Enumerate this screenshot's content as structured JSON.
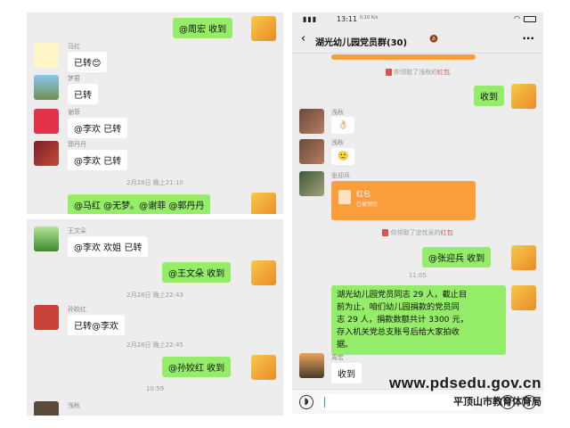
{
  "panel_a": {
    "top_msg": "@周宏  收到",
    "m1": {
      "name": "马红",
      "text": "已转😊"
    },
    "m2": {
      "name": "梦君",
      "text": "已转"
    },
    "m3": {
      "name": "谢菲",
      "text": "@李欢  已转"
    },
    "m4": {
      "name": "郭丹丹",
      "text": "@李欢  已转"
    },
    "time1": "2月28日 晚上21:10",
    "bottom_msg": "@马红 @无梦。@谢菲 @郭丹丹"
  },
  "panel_b": {
    "m1": {
      "name": "王文朵",
      "text": "@李欢  欢姐 已转"
    },
    "m2": {
      "text": "@王文朵  收到"
    },
    "time1": "2月28日 晚上22:43",
    "m3": {
      "name": "孙姣红",
      "text": "已转@李欢"
    },
    "time2": "2月28日 晚上22:45",
    "m4": {
      "text": "@孙姣红  收到"
    },
    "time3": "10:59",
    "m5": {
      "name": "浅秋"
    }
  },
  "panel_c": {
    "status_time": "13:11",
    "status_sub": "0.10 K/s",
    "title": "湖光幼儿园党员群(30)",
    "sys1": {
      "prefix": "你领取了浅秋的",
      "link": "红包"
    },
    "m1": {
      "text": "收到"
    },
    "m2": {
      "name": "浅秋",
      "text": "👌🏻"
    },
    "m3": {
      "name": "浅秋",
      "text": "🙂"
    },
    "m4": {
      "name": "张迎兵",
      "packet_title": "红包",
      "packet_sub": "已被领完"
    },
    "sys2": {
      "prefix": "你领取了忠忧泉的",
      "link": "红包"
    },
    "m5": {
      "text": "@张迎兵  收到"
    },
    "time1": "11:05",
    "m6": {
      "text_lines": [
        "湖光幼儿园党员同志 29 人，截止目",
        "前为止，咱们幼儿园捐款的党员同",
        "志 29 人，捐款数额共计 3300 元，",
        "存入机关党总支账号后给大家拍收",
        "据。"
      ]
    },
    "m7": {
      "name": "周宏",
      "text": "收到"
    }
  },
  "watermark": {
    "url": "www.pdsedu.gov.cn",
    "org": "平顶山市教育体育局"
  },
  "colors": {
    "chat_bg": "#ededed",
    "green_bubble": "#95ec69",
    "red_packet": "#fa9d3b"
  }
}
